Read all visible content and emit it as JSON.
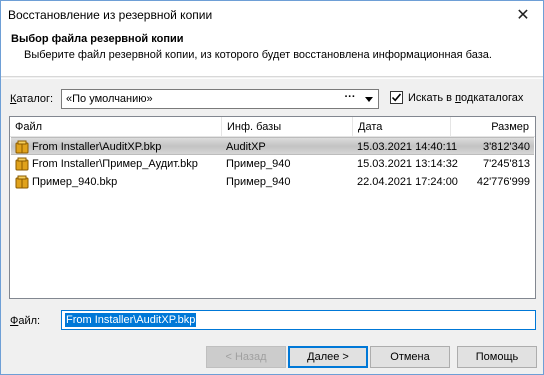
{
  "window": {
    "title": "Восстановление из резервной копии",
    "close_glyph": "✕"
  },
  "header": {
    "title": "Выбор файла резервной копии",
    "subtitle": "Выберите файл резервной копии, из которого будет восстановлена информационная база."
  },
  "catalog": {
    "label_underlined": "К",
    "label_rest": "аталог:",
    "value": "«По умолчанию»",
    "dots": "···"
  },
  "subdirs_checkbox": {
    "label_pre": "Искать в ",
    "label_underlined": "п",
    "label_post": "одкаталогах",
    "checked": true
  },
  "table": {
    "columns": [
      "Файл",
      "Инф. базы",
      "Дата",
      "Размер"
    ],
    "rows": [
      {
        "file": "From Installer\\AuditXP.bkp",
        "base": "AuditXP",
        "date": "15.03.2021 14:40:11",
        "size": "3'812'340",
        "selected": true
      },
      {
        "file": "From Installer\\Пример_Аудит.bkp",
        "base": "Пример_940",
        "date": "15.03.2021 13:14:32",
        "size": "7'245'813",
        "selected": false
      },
      {
        "file": "Пример_940.bkp",
        "base": "Пример_940",
        "date": "22.04.2021 17:24:00",
        "size": "42'776'999",
        "selected": false
      }
    ]
  },
  "file_field": {
    "label_underlined": "Ф",
    "label_rest": "айл:",
    "value": "From Installer\\AuditXP.bkp"
  },
  "buttons": {
    "back": "< Назад",
    "next": "Далее >",
    "cancel": "Отмена",
    "help": "Помощь"
  },
  "colors": {
    "accent": "#0078d7",
    "icon_gold": "#e0a21c"
  }
}
